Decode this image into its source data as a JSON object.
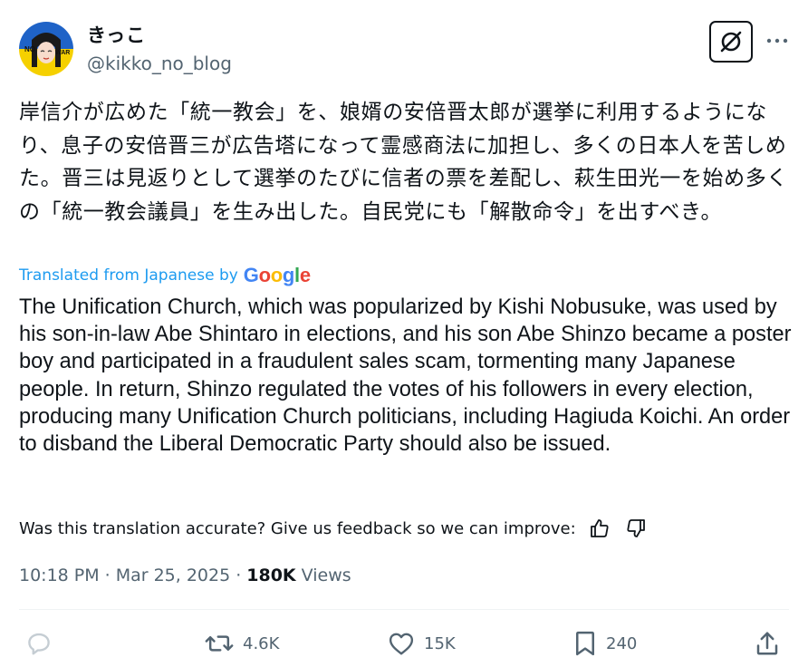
{
  "author": {
    "display_name": "きっこ",
    "handle": "@kikko_no_blog",
    "avatar_badge_left": "NO",
    "avatar_badge_right": "WAR"
  },
  "icons": {
    "grok": "grok-icon",
    "more": "more-dots-icon",
    "reply": "reply-icon",
    "retweet": "retweet-icon",
    "like": "heart-icon",
    "bookmark": "bookmark-icon",
    "share": "share-icon",
    "thumbs_up": "thumbs-up-icon",
    "thumbs_down": "thumbs-down-icon"
  },
  "post": {
    "original_text": "岸信介が広めた「統一教会」を、娘婿の安倍晋太郎が選挙に利用するようになり、息子の安倍晋三が広告塔になって霊感商法に加担し、多くの日本人を苦しめた。晋三は見返りとして選挙のたびに信者の票を差配し、萩生田光一を始め多くの「統一教会議員」を生み出した。自民党にも「解散命令」を出すべき。",
    "translated_from": "Translated from Japanese by",
    "translation_provider": "Google",
    "translation_text": "The Unification Church, which was popularized by Kishi Nobusuke, was used by his son-in-law Abe Shintaro in elections, and his son Abe Shinzo became a poster boy and participated in a fraudulent sales scam, tormenting many Japanese people. In return, Shinzo regulated the votes of his followers in every election, producing many Unification Church politicians, including Hagiuda Koichi. An order to disband the Liberal Democratic Party should also be issued.",
    "feedback_prompt": "Was this translation accurate? Give us feedback so we can improve:"
  },
  "meta": {
    "time": "10:18 PM",
    "separator": "·",
    "date": "Mar 25, 2025",
    "views_count": "180K",
    "views_label": "Views"
  },
  "actions": {
    "retweets": "4.6K",
    "likes": "15K",
    "bookmarks": "240"
  },
  "colors": {
    "accent_blue": "#1d9bf0",
    "muted_text": "#536471",
    "main_text": "#0f1419",
    "reply_icon": "#c5cdd3"
  }
}
